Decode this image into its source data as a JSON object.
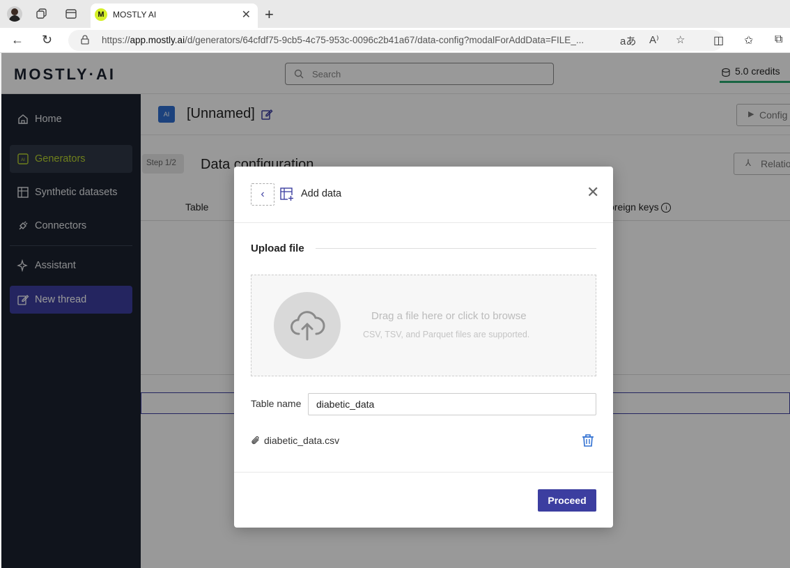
{
  "browser": {
    "tab_title": "MOSTLY AI",
    "favicon_letter": "M",
    "url_prefix": "https://",
    "url_host": "app.mostly.ai",
    "url_path": "/d/generators/64cfdf75-9cb5-4c75-953c-0096c2b41a67/data-config?modalForAddData=FILE_...",
    "translate_glyph": "aあ",
    "read_aloud_glyph": "A⁾"
  },
  "app": {
    "logo": "MOSTLY·AI",
    "search_placeholder": "Search",
    "credits": "5.0 credits"
  },
  "sidebar": {
    "items": [
      {
        "label": "Home",
        "icon": "home-icon"
      },
      {
        "label": "Generators",
        "icon": "generator-icon"
      },
      {
        "label": "Synthetic datasets",
        "icon": "dataset-icon"
      },
      {
        "label": "Connectors",
        "icon": "plug-icon"
      },
      {
        "label": "Assistant",
        "icon": "sparkle-icon"
      },
      {
        "label": "New thread",
        "icon": "edit-icon"
      }
    ]
  },
  "main": {
    "generator_badge": "AI",
    "title": "[Unnamed]",
    "configure_label": "Config",
    "step_badge": "Step 1/2",
    "step_title": "Data configuration",
    "relations_label": "Relatio",
    "col_table": "Table",
    "col_fk": "oreign keys"
  },
  "modal": {
    "title": "Add data",
    "section_title": "Upload file",
    "dropzone_main": "Drag a file here or click to browse",
    "dropzone_sub": "CSV, TSV, and Parquet files are supported.",
    "table_name_label": "Table name",
    "table_name_value": "diabetic_data",
    "file_name": "diabetic_data.csv",
    "proceed_label": "Proceed"
  },
  "colors": {
    "sidebar_bg": "#1b2230",
    "accent": "#3c3ea0",
    "active_text": "#b8d430",
    "credits_bar": "#2aa870"
  }
}
